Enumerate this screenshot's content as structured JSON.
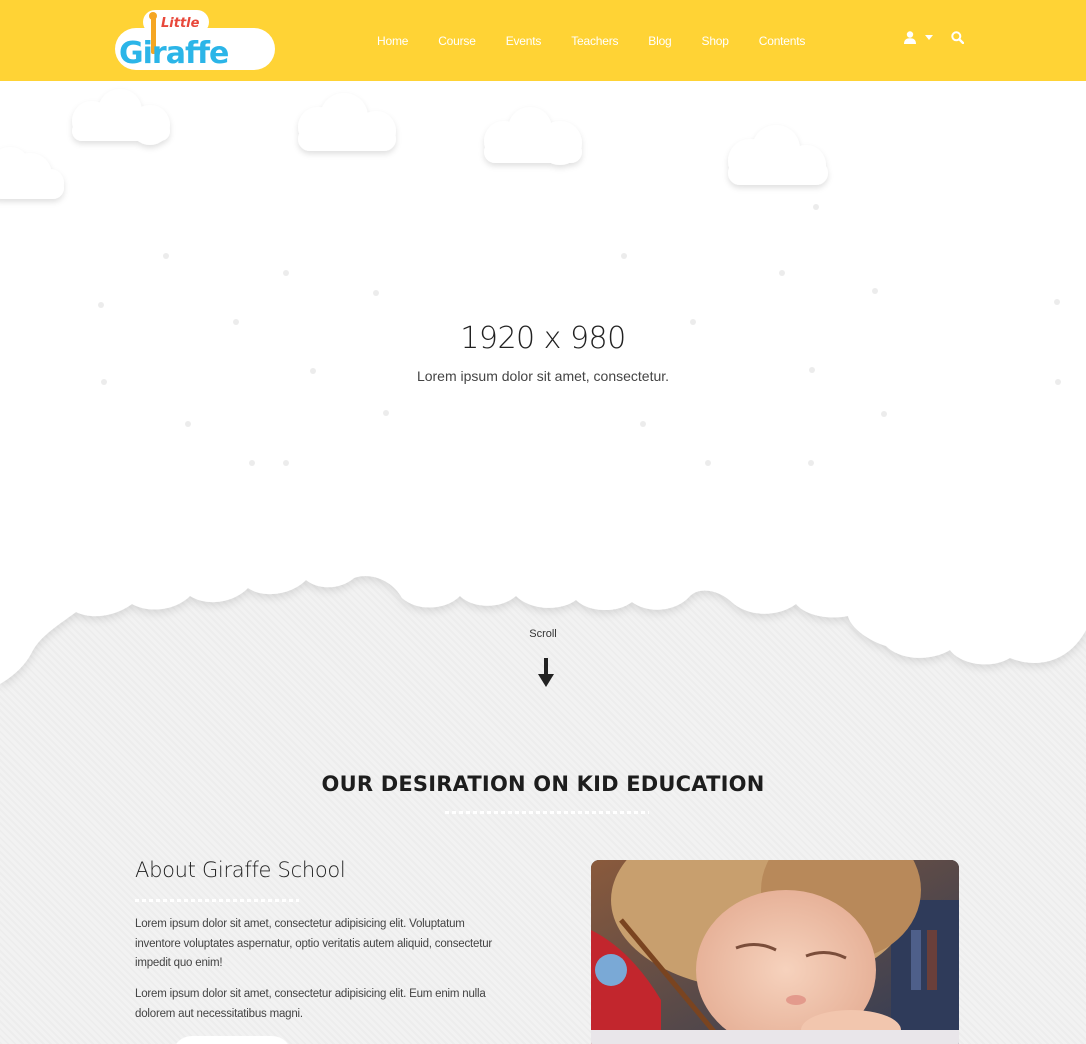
{
  "brand": {
    "logo_small_text": "Little",
    "logo_big_text": "Giraffe"
  },
  "nav": {
    "items": [
      {
        "label": "Home"
      },
      {
        "label": "Course"
      },
      {
        "label": "Events"
      },
      {
        "label": "Teachers"
      },
      {
        "label": "Blog"
      },
      {
        "label": "Shop"
      },
      {
        "label": "Contents"
      }
    ]
  },
  "header_tools": {
    "icons": [
      "user-icon",
      "caret-down-icon",
      "search-icon"
    ]
  },
  "hero": {
    "title": "1920 x 980",
    "subtitle": "Lorem ipsum dolor sit amet, consectetur."
  },
  "scroll": {
    "label": "Scroll",
    "icon": "arrow-down-icon"
  },
  "section": {
    "title": "OUR DESIRATION ON KID EDUCATION"
  },
  "about": {
    "title": "About Giraffe School",
    "paragraphs": [
      "Lorem ipsum dolor sit amet, consectetur adipisicing elit. Voluptatum inventore voluptates aspernatur, optio veritatis autem aliquid, consectetur impedit quo enim!",
      "Lorem ipsum dolor sit amet, consectetur adipisicing elit. Eum enim nulla dolorem aut necessitatibus magni."
    ]
  },
  "colors": {
    "header_bg": "#ffd335",
    "nav_text": "#ffffff",
    "page_bg": "#f2f2f2",
    "heading": "#1d1d1d"
  }
}
